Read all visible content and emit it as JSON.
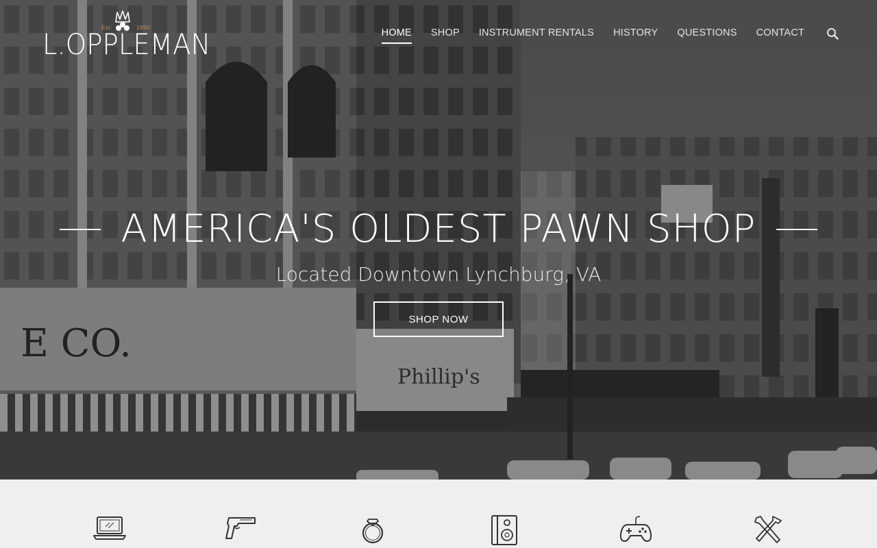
{
  "brand": {
    "name": "L.OPPLEMAN",
    "est": "Est.",
    "year": "1890",
    "accent": "#c9894d"
  },
  "nav": {
    "items": [
      {
        "label": "HOME",
        "active": true
      },
      {
        "label": "SHOP",
        "active": false
      },
      {
        "label": "INSTRUMENT RENTALS",
        "active": false
      },
      {
        "label": "HISTORY",
        "active": false
      },
      {
        "label": "QUESTIONS",
        "active": false
      },
      {
        "label": "CONTACT",
        "active": false
      }
    ],
    "search_icon": "search-icon"
  },
  "hero": {
    "headline": "AMERICA'S OLDEST PAWN SHOP",
    "subline": "Located Downtown Lynchburg, VA",
    "cta": "SHOP NOW"
  },
  "categories": [
    {
      "icon": "laptop-icon"
    },
    {
      "icon": "handgun-icon"
    },
    {
      "icon": "ring-icon"
    },
    {
      "icon": "speaker-icon"
    },
    {
      "icon": "game-controller-icon"
    },
    {
      "icon": "tools-icon"
    }
  ]
}
